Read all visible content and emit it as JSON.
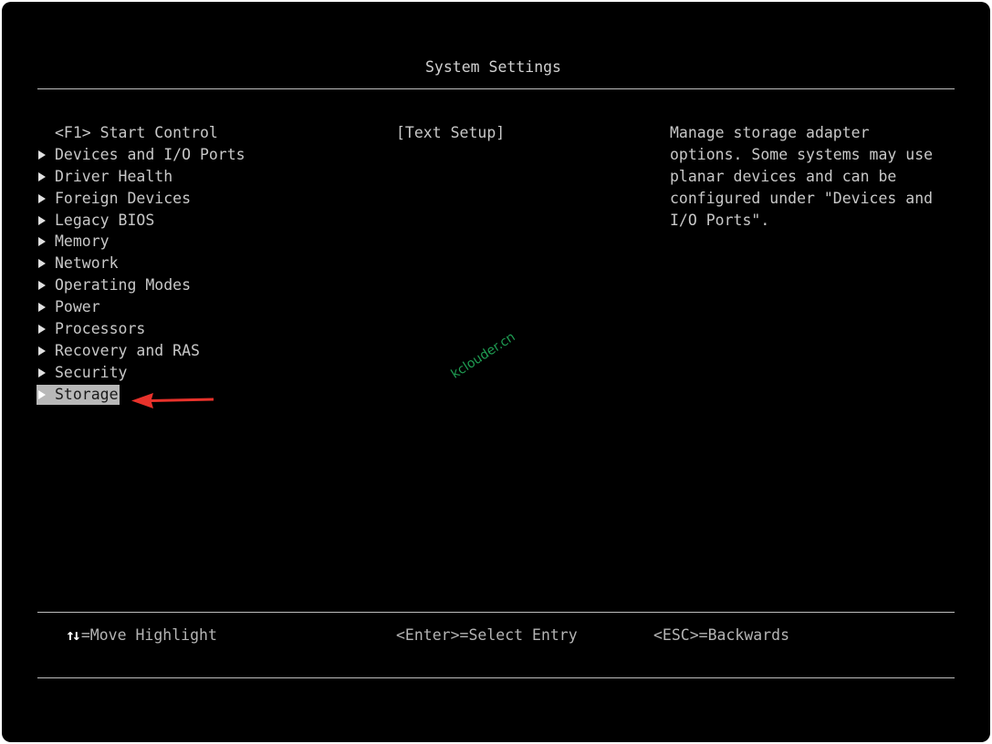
{
  "window": {
    "title": "System Settings"
  },
  "menu": {
    "items": [
      {
        "label": "<F1> Start Control",
        "submenu": false
      },
      {
        "label": "Devices and I/O Ports",
        "submenu": true
      },
      {
        "label": "Driver Health",
        "submenu": true
      },
      {
        "label": "Foreign Devices",
        "submenu": true
      },
      {
        "label": "Legacy BIOS",
        "submenu": true
      },
      {
        "label": "Memory",
        "submenu": true
      },
      {
        "label": "Network",
        "submenu": true
      },
      {
        "label": "Operating Modes",
        "submenu": true
      },
      {
        "label": "Power",
        "submenu": true
      },
      {
        "label": "Processors",
        "submenu": true
      },
      {
        "label": "Recovery and RAS",
        "submenu": true
      },
      {
        "label": "Security",
        "submenu": true
      },
      {
        "label": "Storage",
        "submenu": true,
        "selected": true
      }
    ]
  },
  "middle": {
    "text": "[Text Setup]"
  },
  "help": {
    "text": "Manage storage adapter\noptions. Some systems may use\nplanar devices and can be\nconfigured under \"Devices and\nI/O Ports\"."
  },
  "footer": {
    "move_arrows": "↑↓",
    "move_label": "=Move Highlight",
    "select_label": "<Enter>=Select Entry",
    "back_label": "<ESC>=Backwards"
  },
  "watermark": {
    "text": "kclouder.cn"
  },
  "colors": {
    "background": "#000000",
    "text": "#c8c8c8",
    "highlight": "#b8b8b8",
    "annotation_arrow": "#e8322b",
    "watermark": "#1f9e53"
  }
}
